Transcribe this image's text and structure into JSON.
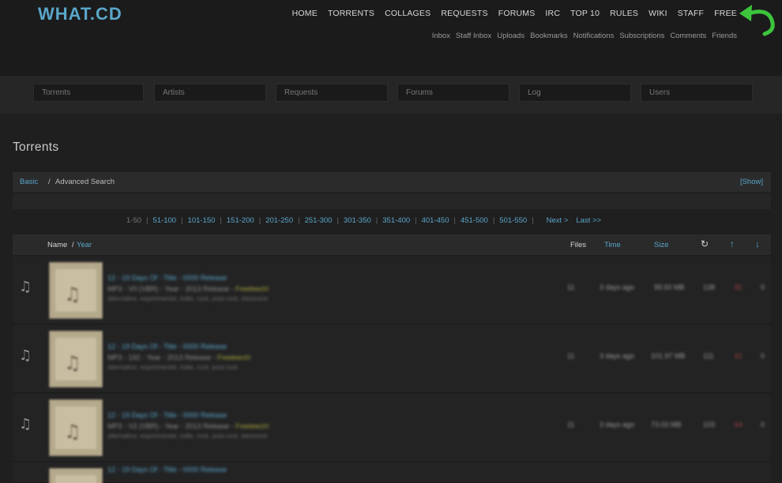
{
  "header": {
    "logo": "WHAT.CD",
    "main_nav": [
      "HOME",
      "TORRENTS",
      "COLLAGES",
      "REQUESTS",
      "FORUMS",
      "IRC",
      "TOP 10",
      "RULES",
      "WIKI",
      "STAFF",
      "FREE"
    ],
    "sub_nav": [
      "Inbox",
      "Staff Inbox",
      "Uploads",
      "Bookmarks",
      "Notifications",
      "Subscriptions",
      "Comments",
      "Friends"
    ],
    "arrow_icon": "green-curved-arrow-icon",
    "arrow_color": "#3cc43c"
  },
  "search": {
    "fields": [
      "Torrents",
      "Artists",
      "Requests",
      "Forums",
      "Log",
      "Users"
    ]
  },
  "page": {
    "title": "Torrents",
    "mode_basic": "Basic",
    "mode_sep": "/",
    "mode_advanced": "Advanced Search",
    "show_link": "[Show]"
  },
  "pagination": {
    "current": "1-50",
    "pages": [
      "51-100",
      "101-150",
      "151-200",
      "201-250",
      "251-300",
      "301-350",
      "351-400",
      "401-450",
      "451-500",
      "501-550"
    ],
    "next": "Next >",
    "last": "Last >>"
  },
  "table": {
    "name_col": "Name",
    "name_sep": "/",
    "year_col": "Year",
    "files_col": "Files",
    "time_col": "Time",
    "size_col": "Size",
    "snatch_icon": "snatched-refresh-icon",
    "seeders_icon": "seeders-up-arrow-icon",
    "leechers_icon": "leechers-down-arrow-icon"
  },
  "rows": [
    {
      "title": "12 - 19 Days Of - Title - 0000 Release",
      "info": "MP3 - V0 (VBR) - Year - 2013 Release -",
      "freeleech": "Freeleech!",
      "tags": "alternative, experimental, indie, rock, post.rock, electronic",
      "files": "11",
      "time": "3 days ago",
      "size": "99.50 MB",
      "snatches": "138",
      "seeders": "81",
      "leechers": "0",
      "type_icon": "music-note-icon"
    },
    {
      "title": "12 - 19 Days Of - Title - 0000 Release",
      "info": "MP3 - 192 - Year - 2013 Release -",
      "freeleech": "Freeleech!",
      "tags": "alternative, experimental, indie, rock, post.rock",
      "files": "11",
      "time": "3 days ago",
      "size": "101.97 MB",
      "snatches": "111",
      "seeders": "61",
      "leechers": "0",
      "type_icon": "music-note-icon"
    },
    {
      "title": "12 - 19 Days Of - Title - 0000 Release",
      "info": "MP3 - V2 (VBR) - Year - 2013 Release -",
      "freeleech": "Freeleech!",
      "tags": "alternative, experimental, indie, rock, post.rock, electronic",
      "files": "11",
      "time": "3 days ago",
      "size": "73.03 MB",
      "snatches": "103",
      "seeders": "64",
      "leechers": "0",
      "type_icon": "music-note-icon"
    },
    {
      "title": "12 - 19 Days Of - Title - 0000 Release",
      "info": "",
      "freeleech": "",
      "tags": "",
      "files": "",
      "time": "",
      "size": "",
      "snatches": "",
      "seeders": "",
      "leechers": "",
      "type_icon": "music-note-icon"
    }
  ]
}
